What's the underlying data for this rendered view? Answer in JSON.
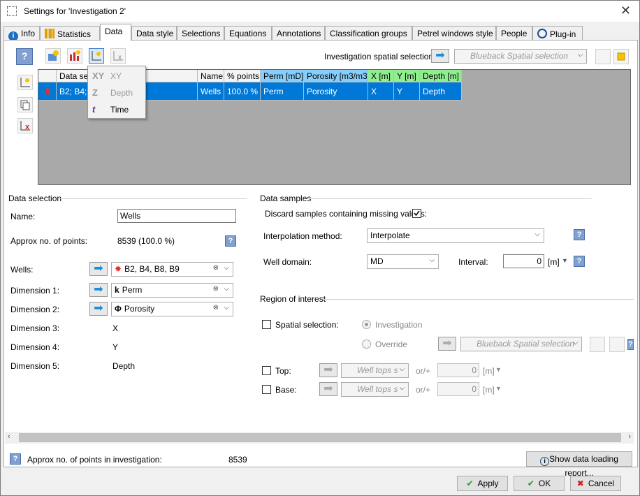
{
  "window": {
    "title": "Settings for 'Investigation 2'"
  },
  "tabs": [
    {
      "label": "Info"
    },
    {
      "label": "Statistics"
    },
    {
      "label": "Data"
    },
    {
      "label": "Data style"
    },
    {
      "label": "Selections"
    },
    {
      "label": "Equations"
    },
    {
      "label": "Annotations"
    },
    {
      "label": "Classification groups"
    },
    {
      "label": "Petrel windows style"
    },
    {
      "label": "People"
    },
    {
      "label": "Plug-in"
    }
  ],
  "toolbar": {
    "spatial_label": "Investigation spatial selection:",
    "spatial_value": "Blueback Spatial selection"
  },
  "grid": {
    "headers": [
      "Data set",
      "Name",
      "% points",
      "Perm [mD]",
      "Porosity [m3/m3]",
      "X [m]",
      "Y [m]",
      "Depth [m]"
    ],
    "row": [
      "B2; B4; B",
      "Wells",
      "100.0 %",
      "Perm",
      "Porosity",
      "X",
      "Y",
      "Depth"
    ]
  },
  "dimension_menu": {
    "items": [
      {
        "icon": "XY",
        "label": "XY",
        "enabled": false
      },
      {
        "icon": "Z",
        "label": "Depth",
        "enabled": false
      },
      {
        "icon": "t",
        "label": "Time",
        "enabled": true
      }
    ]
  },
  "data_selection": {
    "header": "Data selection",
    "name_label": "Name:",
    "name_value": "Wells",
    "approx_label": "Approx no. of points:",
    "approx_value": "8539 (100.0 %)",
    "wells_label": "Wells:",
    "wells_value": "B2, B4, B8, B9",
    "dim1_label": "Dimension 1:",
    "dim1_value": "Perm",
    "dim2_label": "Dimension 2:",
    "dim2_value": "Porosity",
    "dim3_label": "Dimension 3:",
    "dim3_value": "X",
    "dim4_label": "Dimension 4:",
    "dim4_value": "Y",
    "dim5_label": "Dimension 5:",
    "dim5_value": "Depth"
  },
  "data_samples": {
    "header": "Data samples",
    "discard_label": "Discard samples containing missing values:",
    "discard_checked": true,
    "interp_label": "Interpolation method:",
    "interp_value": "Interpolate",
    "domain_label": "Well domain:",
    "domain_value": "MD",
    "interval_label": "Interval:",
    "interval_value": "0",
    "interval_unit": "[m]"
  },
  "region": {
    "header": "Region of interest",
    "spatial_label": "Spatial selection:",
    "investigation_label": "Investigation",
    "override_label": "Override",
    "override_value": "Blueback Spatial selection",
    "top_label": "Top:",
    "top_value": "Well tops s",
    "top_offset_label": "or/+",
    "top_offset": "0",
    "top_unit": "[m]",
    "base_label": "Base:",
    "base_value": "Well tops s",
    "base_offset_label": "or/+",
    "base_offset": "0",
    "base_unit": "[m]"
  },
  "footer": {
    "approx_inv_label": "Approx no. of points in investigation:",
    "approx_inv_value": "8539",
    "report_button": "Show data loading report...",
    "apply": "Apply",
    "ok": "OK",
    "cancel": "Cancel"
  },
  "colors": {
    "accent": "#0078d7",
    "arrow": "#1a8ed8",
    "apply_check": "#1e9e1e",
    "cancel_x": "#d02020"
  }
}
